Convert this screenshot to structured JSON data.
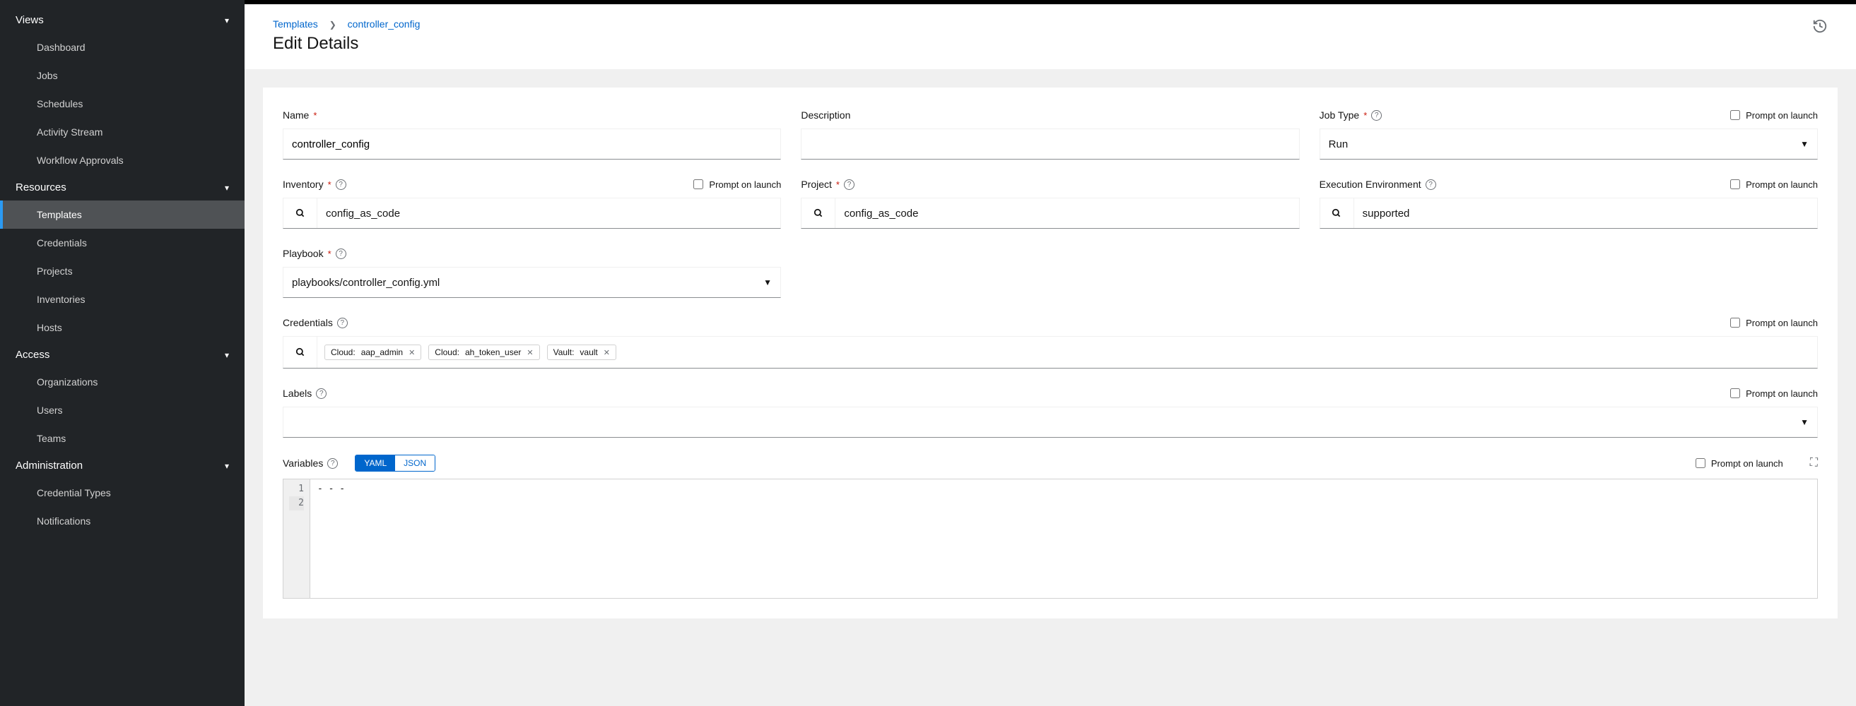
{
  "sidebar": {
    "groups": [
      {
        "title": "Views",
        "items": [
          "Dashboard",
          "Jobs",
          "Schedules",
          "Activity Stream",
          "Workflow Approvals"
        ],
        "active": null
      },
      {
        "title": "Resources",
        "items": [
          "Templates",
          "Credentials",
          "Projects",
          "Inventories",
          "Hosts"
        ],
        "active": 0
      },
      {
        "title": "Access",
        "items": [
          "Organizations",
          "Users",
          "Teams"
        ],
        "active": null
      },
      {
        "title": "Administration",
        "items": [
          "Credential Types",
          "Notifications"
        ],
        "active": null
      }
    ]
  },
  "breadcrumbs": {
    "a": "Templates",
    "b": "controller_config"
  },
  "page_title": "Edit Details",
  "prompt_label": "Prompt on launch",
  "fields": {
    "name": {
      "label": "Name",
      "value": "controller_config"
    },
    "description": {
      "label": "Description",
      "value": ""
    },
    "job_type": {
      "label": "Job Type",
      "value": "Run"
    },
    "inventory": {
      "label": "Inventory",
      "value": "config_as_code"
    },
    "project": {
      "label": "Project",
      "value": "config_as_code"
    },
    "exec_env": {
      "label": "Execution Environment",
      "value": "supported"
    },
    "playbook": {
      "label": "Playbook",
      "value": "playbooks/controller_config.yml"
    },
    "credentials": {
      "label": "Credentials",
      "chips": [
        {
          "k": "Cloud:",
          "v": "aap_admin"
        },
        {
          "k": "Cloud:",
          "v": "ah_token_user"
        },
        {
          "k": "Vault:",
          "v": "vault"
        }
      ]
    },
    "labels": {
      "label": "Labels"
    },
    "variables": {
      "label": "Variables",
      "yaml": "YAML",
      "json": "JSON",
      "lines": [
        "1",
        "2"
      ],
      "content": "- - -"
    }
  }
}
